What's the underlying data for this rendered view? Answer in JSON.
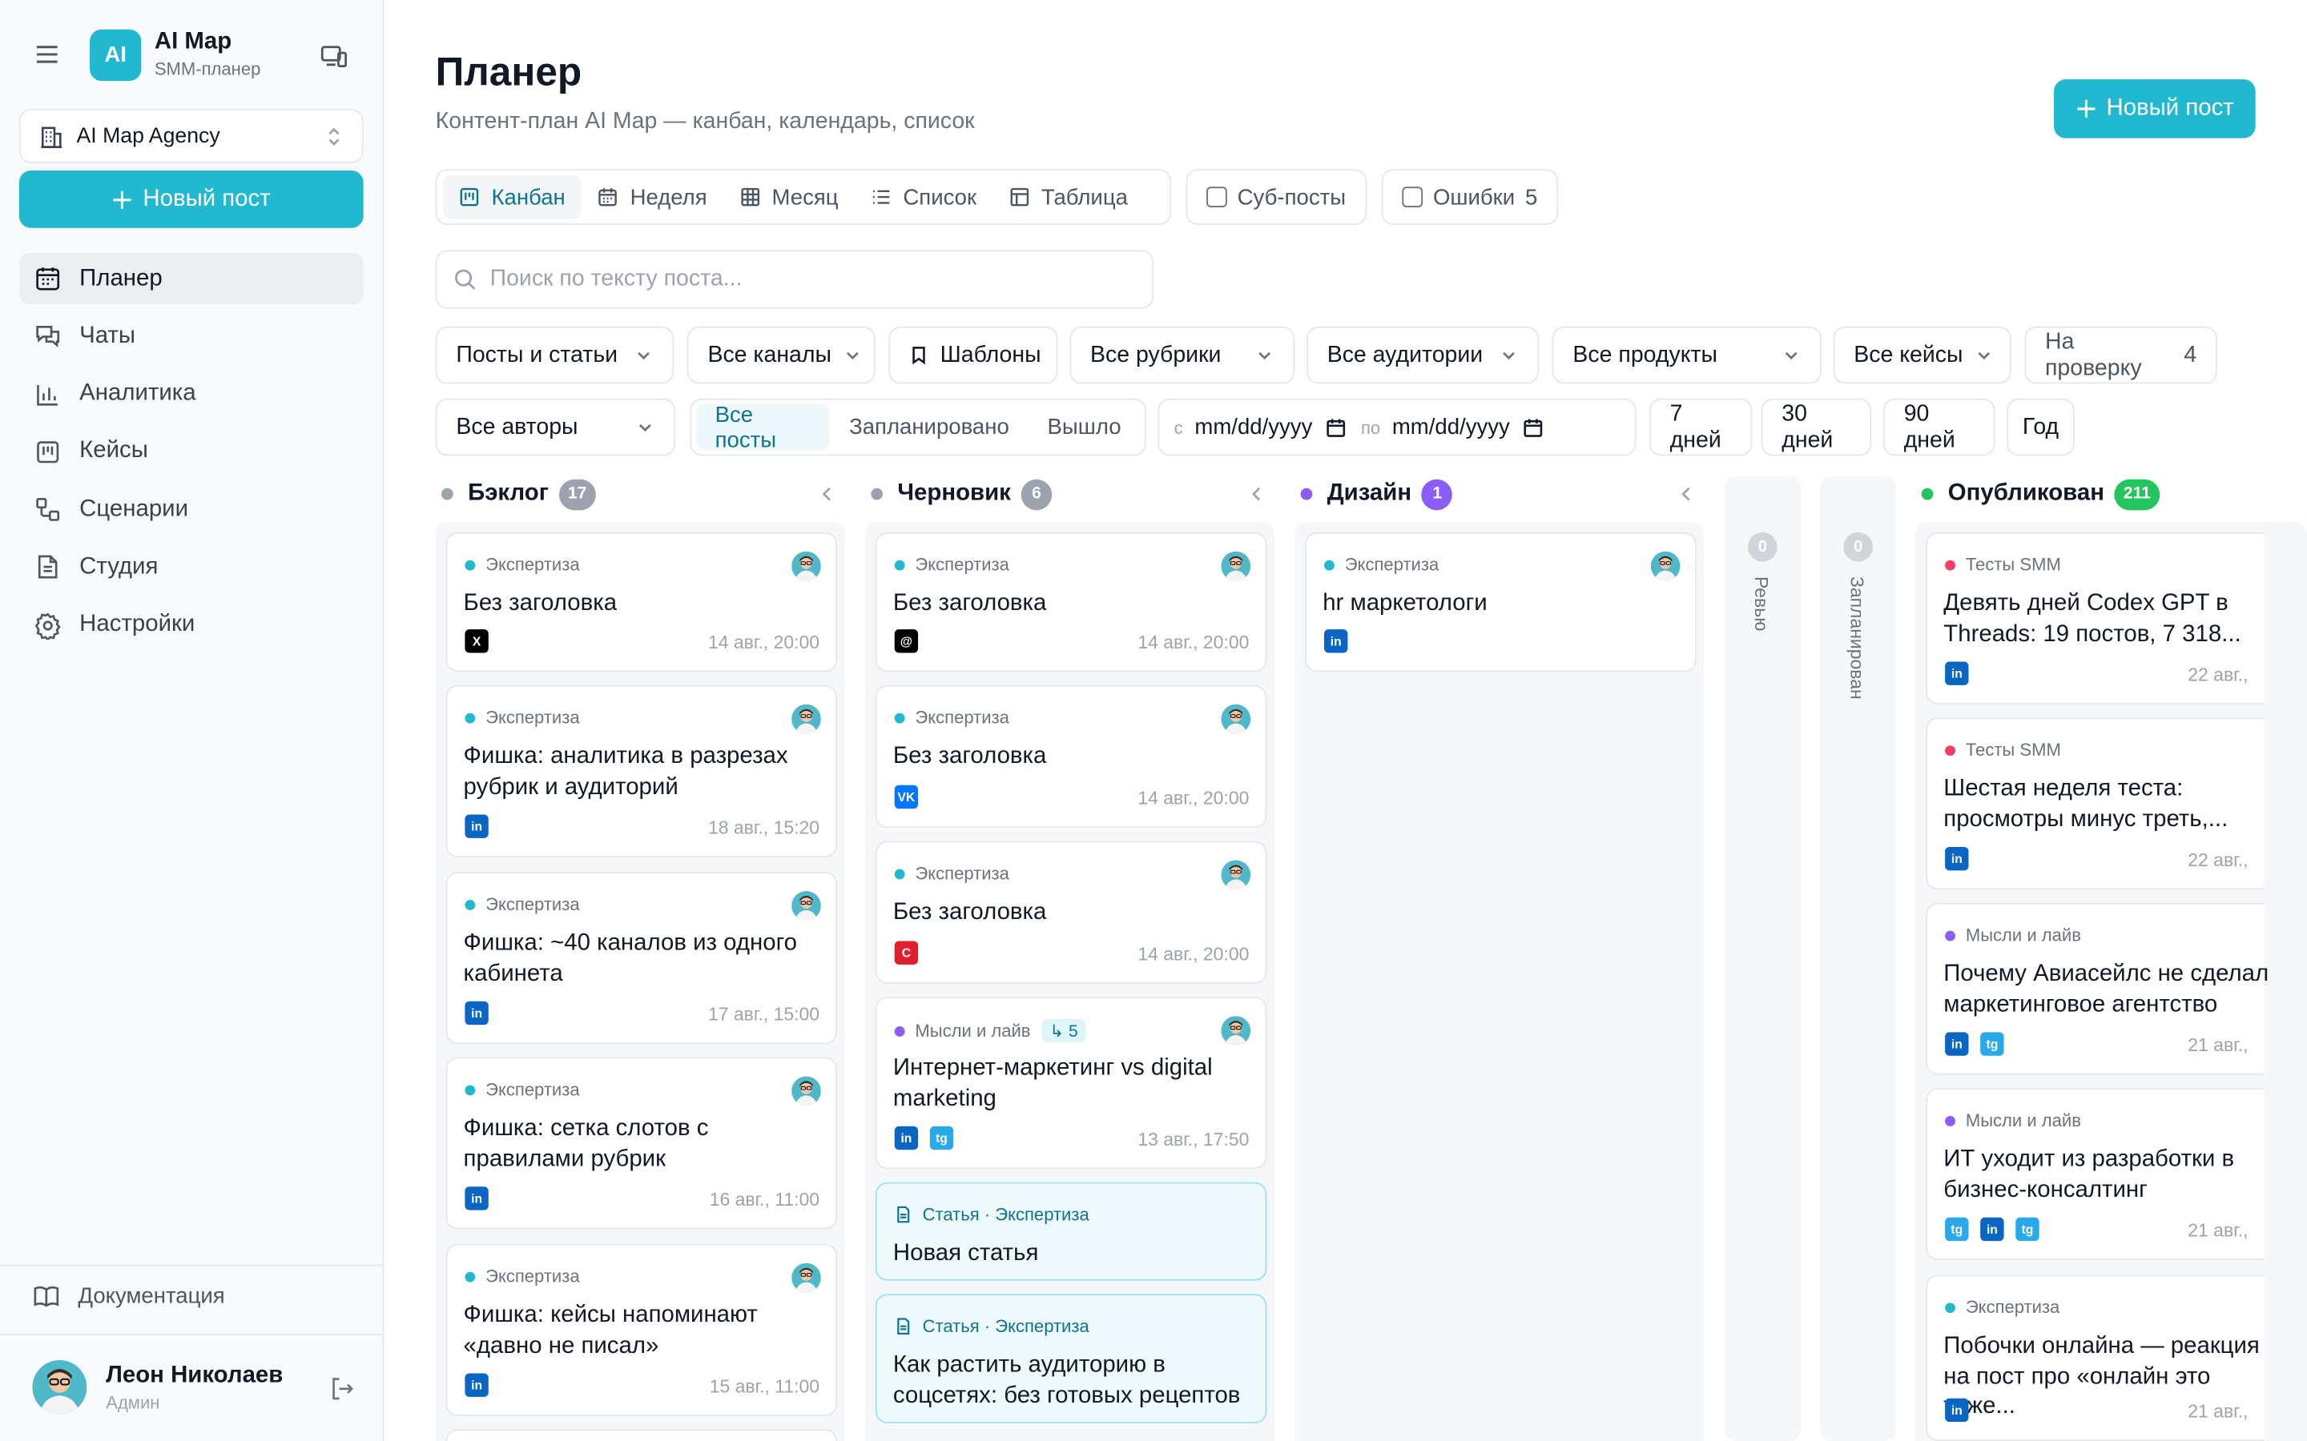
{
  "sidebar": {
    "logo_text": "AI",
    "app_name": "AI Map",
    "app_sub": "SMM-планер",
    "agency": "AI Map Agency",
    "new_post": "Новый пост",
    "nav": [
      {
        "label": "Планер",
        "icon": "calendar-icon"
      },
      {
        "label": "Чаты",
        "icon": "chats-icon"
      },
      {
        "label": "Аналитика",
        "icon": "analytics-icon"
      },
      {
        "label": "Кейсы",
        "icon": "cases-icon"
      },
      {
        "label": "Сценарии",
        "icon": "scenarios-icon"
      },
      {
        "label": "Студия",
        "icon": "studio-icon"
      },
      {
        "label": "Настройки",
        "icon": "settings-icon"
      }
    ],
    "docs": "Документация",
    "user": {
      "name": "Леон Николаев",
      "role": "Админ"
    }
  },
  "header": {
    "title": "Планер",
    "subtitle": "Контент-план AI Map — канбан, календарь, список",
    "new_post": "Новый пост"
  },
  "views": [
    "Канбан",
    "Неделя",
    "Месяц",
    "Список",
    "Таблица"
  ],
  "toggles": {
    "subposts": "Суб-посты",
    "errors": "Ошибки",
    "errors_count": "5"
  },
  "search": {
    "placeholder": "Поиск по тексту поста...",
    "value": ""
  },
  "filters": {
    "type": "Посты и статьи",
    "channels": "Все каналы",
    "templates": "Шаблоны",
    "rubrics": "Все рубрики",
    "audiences": "Все аудитории",
    "products": "Все продукты",
    "cases": "Все кейсы",
    "review": "На проверку",
    "review_count": "4",
    "authors": "Все авторы",
    "status_options": [
      "Все посты",
      "Запланировано",
      "Вышло"
    ],
    "date_from_prefix": "с",
    "date_from": "mm/dd/yyyy",
    "date_to_prefix": "по",
    "date_to": "mm/dd/yyyy",
    "periods": [
      "7 дней",
      "30 дней",
      "90 дней",
      "Год"
    ]
  },
  "colors": {
    "accent": "#22b8cf",
    "backlog": "#9ca3af",
    "draft": "#9ca3af",
    "design": "#8b5cf6",
    "published": "#22c55e"
  },
  "columns": {
    "backlog": {
      "name": "Бэклог",
      "count": "17",
      "cards": [
        {
          "cat": "Экспертиза",
          "title": "Без заголовка",
          "channels": [
            "X"
          ],
          "date": "14 авг., 20:00"
        },
        {
          "cat": "Экспертиза",
          "title": "Фишка: аналитика в разрезах рубрик и аудиторий",
          "channels": [
            "in"
          ],
          "date": "18 авг., 15:20"
        },
        {
          "cat": "Экспертиза",
          "title": "Фишка: ~40 каналов из одного кабинета",
          "channels": [
            "in"
          ],
          "date": "17 авг., 15:00"
        },
        {
          "cat": "Экспертиза",
          "title": "Фишка: сетка слотов с правилами рубрик",
          "channels": [
            "in"
          ],
          "date": "16 авг., 11:00"
        },
        {
          "cat": "Экспертиза",
          "title": "Фишка: кейсы напоминают «давно не писал»",
          "channels": [
            "in"
          ],
          "date": "15 авг., 11:00"
        }
      ]
    },
    "draft": {
      "name": "Черновик",
      "count": "6",
      "cards": [
        {
          "cat": "Экспертиза",
          "title": "Без заголовка",
          "channels": [
            "@"
          ],
          "date": "14 авг., 20:00"
        },
        {
          "cat": "Экспертиза",
          "title": "Без заголовка",
          "channels": [
            "VK"
          ],
          "date": "14 авг., 20:00"
        },
        {
          "cat": "Экспертиза",
          "title": "Без заголовка",
          "channels": [
            "C"
          ],
          "date": "14 авг., 20:00"
        },
        {
          "cat": "Мысли и лайв",
          "sub": "5",
          "title": "Интернет-маркетинг vs digital marketing",
          "channels": [
            "in",
            "tg"
          ],
          "date": "13 авг., 17:50"
        },
        {
          "cat": "Статья · Экспертиза",
          "title": "Новая статья"
        },
        {
          "cat": "Статья · Экспертиза",
          "title": "Как растить аудиторию в соцсетях: без готовых рецептов"
        }
      ]
    },
    "design": {
      "name": "Дизайн",
      "count": "1",
      "cards": [
        {
          "cat": "Экспертиза",
          "title": "hr маркетологи",
          "channels": [
            "in"
          ]
        }
      ]
    },
    "review": {
      "name": "Ревью",
      "count": "0"
    },
    "scheduled": {
      "name": "Запланирован",
      "count": "0"
    },
    "published": {
      "name": "Опубликован",
      "count": "211",
      "cards": [
        {
          "cat": "Тесты SMM",
          "title": "Девять дней Codex GPT в Threads: 19 постов, 7 318...",
          "channels": [
            "in"
          ],
          "date": "22 авг.,"
        },
        {
          "cat": "Тесты SMM",
          "title": "Шестая неделя теста: просмотры минус треть,...",
          "channels": [
            "in"
          ],
          "date": "22 авг.,"
        },
        {
          "cat": "Мысли и лайв",
          "title": "Почему Авиасейлс не сделал маркетинговое агентство",
          "channels": [
            "in",
            "tg"
          ],
          "date": "21 авг.,"
        },
        {
          "cat": "Мысли и лайв",
          "title": "ИТ уходит из разработки в бизнес-консалтинг",
          "channels": [
            "tg",
            "in",
            "tg"
          ],
          "date": "21 авг.,"
        },
        {
          "cat": "Экспертиза",
          "title": "Побочки онлайна — реакция на пост про «онлайн это тоже...",
          "channels": [
            "in"
          ],
          "date": "21 авг.,"
        }
      ]
    }
  }
}
